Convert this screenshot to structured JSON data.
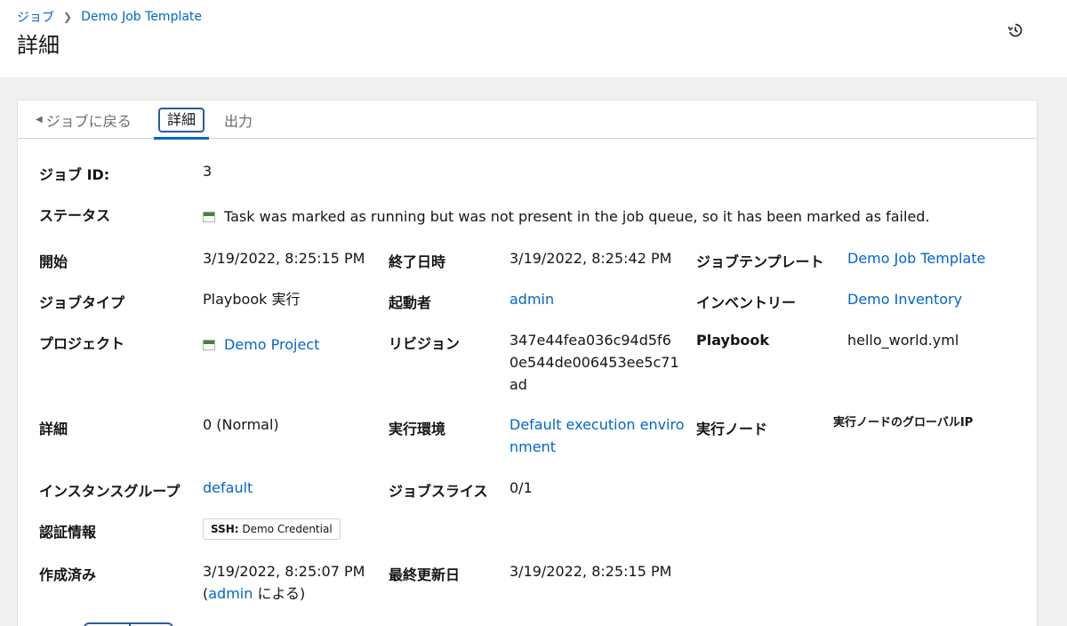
{
  "breadcrumb": {
    "parent": "ジョブ",
    "current": "Demo Job Template"
  },
  "page_title": "詳細",
  "tabs": {
    "back": "ジョブに戻る",
    "details": "詳細",
    "output": "出力"
  },
  "fields": {
    "job_id": {
      "label": "ジョブ ID:",
      "value": "3"
    },
    "status": {
      "label": "ステータス",
      "value": "Task was marked as running but was not present in the job queue, so it has been marked as failed."
    },
    "started": {
      "label": "開始",
      "value": "3/19/2022, 8:25:15 PM"
    },
    "finished": {
      "label": "終了日時",
      "value": "3/19/2022, 8:25:42 PM"
    },
    "job_template": {
      "label": "ジョブテンプレート",
      "value": "Demo Job Template"
    },
    "job_type": {
      "label": "ジョブタイプ",
      "value": "Playbook 実行"
    },
    "launched_by": {
      "label": "起動者",
      "value": "admin"
    },
    "inventory": {
      "label": "インベントリー",
      "value": "Demo Inventory"
    },
    "project": {
      "label": "プロジェクト",
      "value": "Demo Project"
    },
    "revision": {
      "label": "リビジョン",
      "line1": "347e44fea036c94d5f6",
      "line2": "0e544de006453ee5c71",
      "line3": "ad"
    },
    "playbook": {
      "label": "Playbook",
      "value": "hello_world.yml"
    },
    "verbosity": {
      "label": "詳細",
      "value": "0 (Normal)"
    },
    "execution_env": {
      "label": "実行環境",
      "line1": "Default execution enviro",
      "line2": "nment"
    },
    "execution_node": {
      "label": "実行ノード",
      "value": "実行ノードのグローバルIP"
    },
    "instance_group": {
      "label": "インスタンスグループ",
      "value": "default"
    },
    "job_slice": {
      "label": "ジョブスライス",
      "value": "0/1"
    },
    "credentials": {
      "label": "認証情報",
      "chip_type": "SSH:",
      "chip_name": "Demo Credential"
    },
    "created": {
      "label": "作成済み",
      "date": "3/19/2022, 8:25:07 PM",
      "by_open": "(",
      "by_user": "admin",
      "by_close": " による)"
    },
    "modified": {
      "label": "最終更新日",
      "value": "3/19/2022, 8:25:15 PM"
    }
  },
  "icons": {
    "history": "history-icon",
    "back": "caret-left-icon",
    "status": "status-failed-icon",
    "project_status": "project-status-icon"
  },
  "colors": {
    "link": "#0066cc",
    "status_green": "#3e8635",
    "focus": "#2b5aa7"
  }
}
